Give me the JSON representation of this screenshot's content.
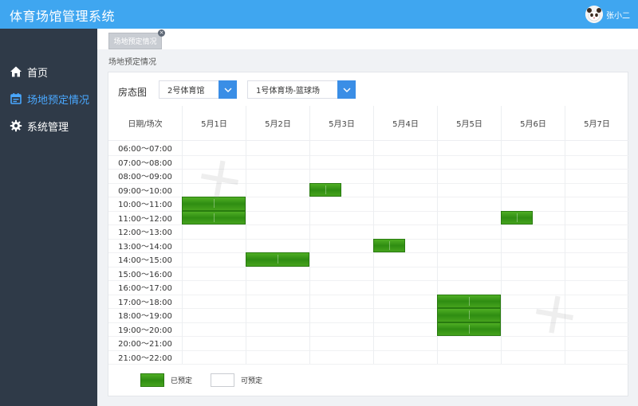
{
  "header": {
    "title": "体育场馆管理系统",
    "user_name": "张小二"
  },
  "sidebar": {
    "items": [
      {
        "label": "首页",
        "icon": "home-icon",
        "active": false
      },
      {
        "label": "场地预定情况",
        "icon": "calendar-icon",
        "active": true
      },
      {
        "label": "系统管理",
        "icon": "gear-icon",
        "active": false
      }
    ]
  },
  "tabs": [
    {
      "label": "场地预定情况"
    }
  ],
  "breadcrumb": "场地预定情况",
  "panel": {
    "label": "房态图",
    "venue_select": "2号体育馆",
    "court_select": "1号体育场-篮球场"
  },
  "table": {
    "corner_header": "日期/场次",
    "days": [
      "5月1日",
      "5月2日",
      "5月3日",
      "5月4日",
      "5月5日",
      "5月6日",
      "5月7日"
    ],
    "slots": [
      "06:00～07:00",
      "07:00～08:00",
      "08:00～09:00",
      "09:00～10:00",
      "10:00～11:00",
      "11:00～12:00",
      "12:00～13:00",
      "13:00～14:00",
      "14:00～15:00",
      "15:00～16:00",
      "16:00～17:00",
      "17:00～18:00",
      "18:00～19:00",
      "19:00～20:00",
      "20:00～21:00",
      "21:00～22:00"
    ],
    "bookings": [
      {
        "day": 0,
        "slot": 4
      },
      {
        "day": 0,
        "slot": 5
      },
      {
        "day": 1,
        "slot": 8
      },
      {
        "day": 2,
        "slot": 3
      },
      {
        "day": 3,
        "slot": 7
      },
      {
        "day": 4,
        "slot": 11
      },
      {
        "day": 4,
        "slot": 12
      },
      {
        "day": 4,
        "slot": 13
      },
      {
        "day": 5,
        "slot": 5
      }
    ]
  },
  "legend": {
    "booked": "已预定",
    "available": "可预定"
  },
  "colors": {
    "topbar": "#3fa6f0",
    "sidebar": "#2f3a48",
    "active_nav": "#4aa8ff",
    "booked": "#3a9a18",
    "select_button": "#3a8ee6"
  }
}
